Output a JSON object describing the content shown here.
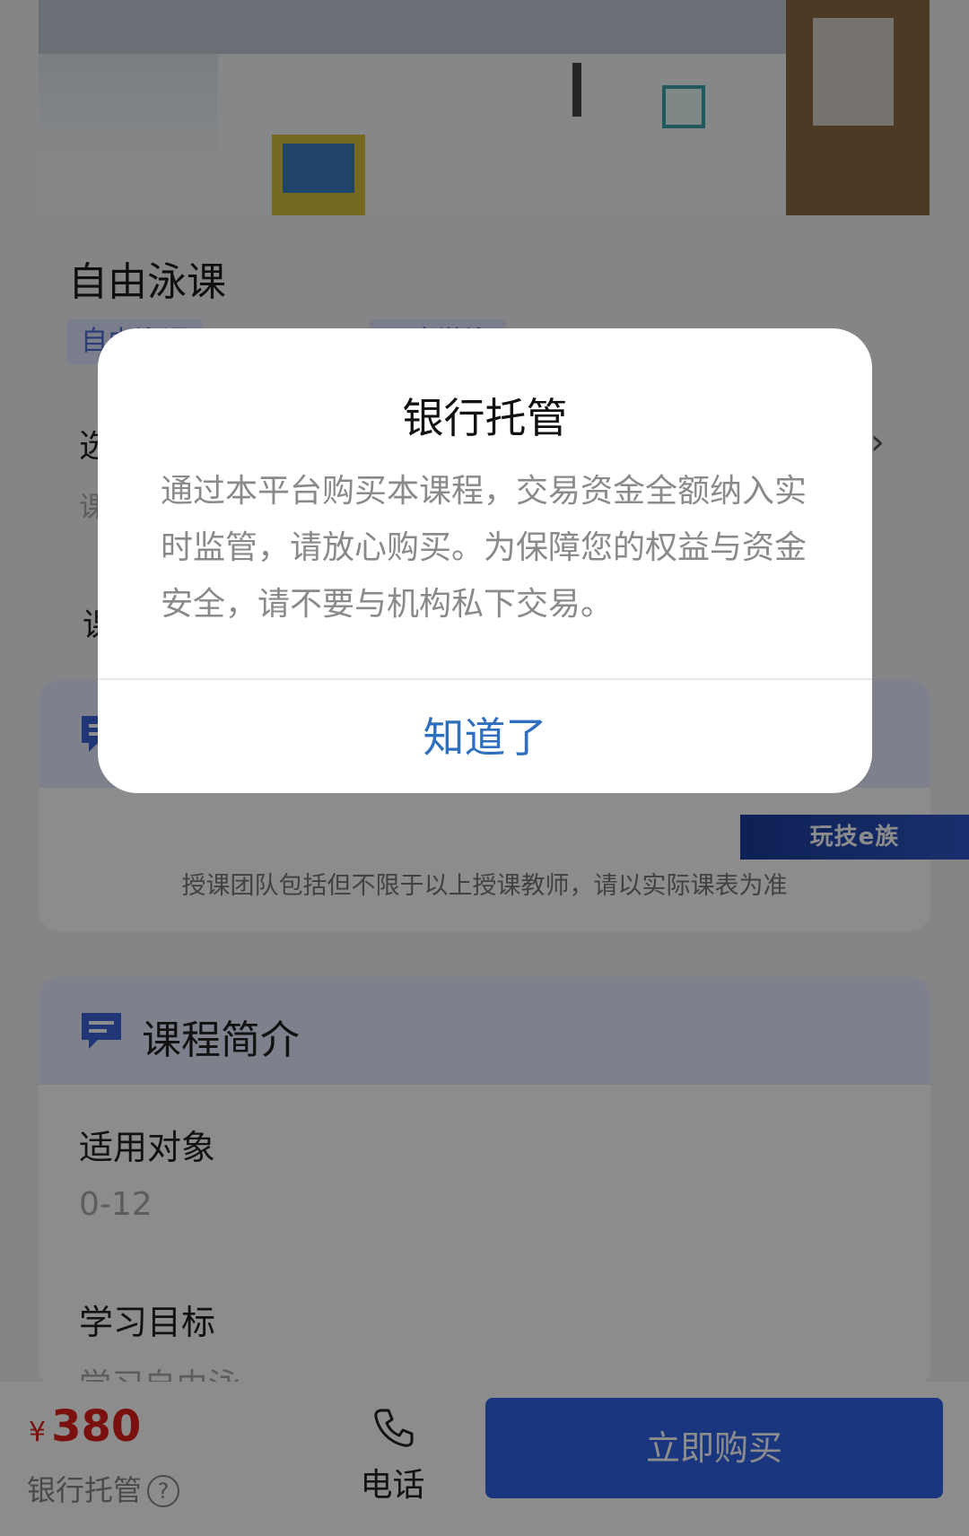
{
  "course": {
    "title": "自由泳课",
    "tags": [
      "自由泳课",
      "",
      "儿童游泳"
    ],
    "select_label": "选",
    "select_sub": "课",
    "teacher_label": "课"
  },
  "team_section": {
    "note": "授课团队包括但不限于以上授课教师，请以实际课表为准"
  },
  "intro_section": {
    "title": "课程简介",
    "fields": [
      {
        "label": "适用对象",
        "value": "0-12"
      },
      {
        "label": "学习目标",
        "value": "学习自由泳"
      }
    ]
  },
  "watermark": "玩技e族",
  "bottom_bar": {
    "currency": "¥",
    "price": "380",
    "escrow_label": "银行托管",
    "help_icon": "?",
    "phone_label": "电话",
    "buy_label": "立即购买"
  },
  "dialog": {
    "title": "银行托管",
    "body": "通过本平台购买本课程，交易资金全额纳入实时监管，请放心购买。为保障您的权益与资金安全，请不要与机构私下交易。",
    "ok_label": "知道了"
  },
  "colors": {
    "accent": "#2f63e7",
    "price": "#e0201b",
    "dialog_button": "#2f6fc0",
    "section_header": "#e6ebff"
  }
}
